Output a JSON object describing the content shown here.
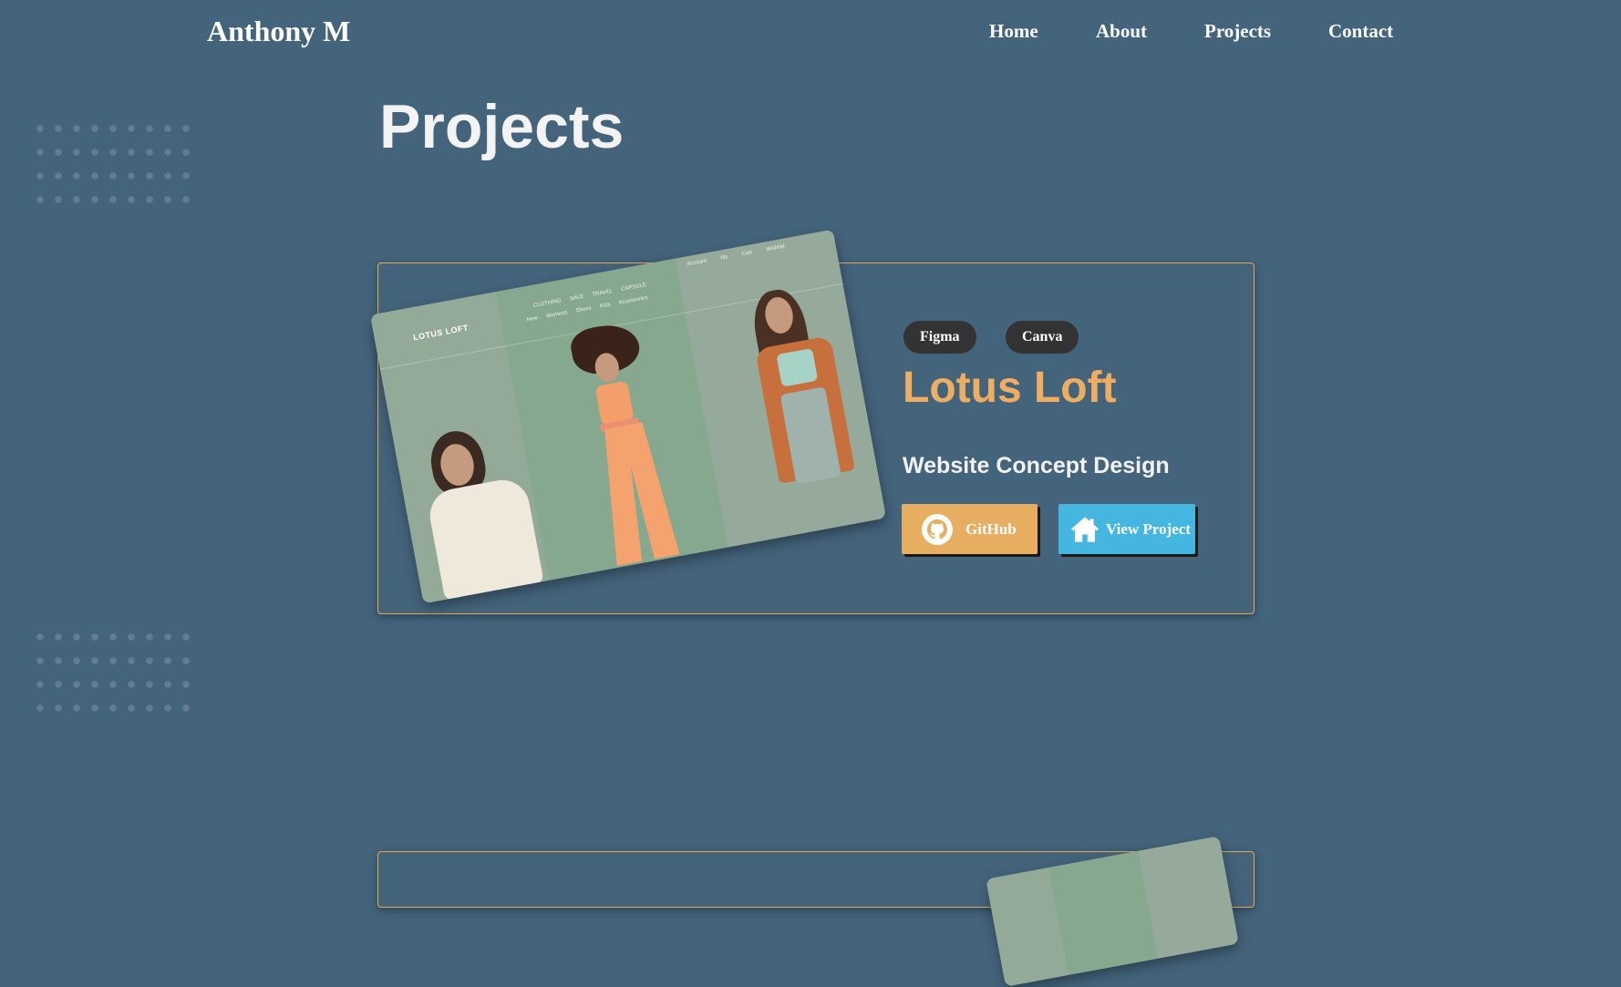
{
  "header": {
    "brand": "Anthony M",
    "nav": [
      {
        "label": "Home"
      },
      {
        "label": "About"
      },
      {
        "label": "Projects"
      },
      {
        "label": "Contact"
      }
    ]
  },
  "page": {
    "title": "Projects"
  },
  "projects": [
    {
      "tags": [
        "Figma",
        "Canva"
      ],
      "title": "Lotus Loft",
      "subtitle": "Website Concept Design",
      "github_label": "GitHub",
      "view_label": "View Project",
      "mockup": {
        "logo": "LOTUS LOFT",
        "menu_top": "CLOTHING SALE TRAVEL CAPSULE",
        "menu_sub": "New Womens Shoes Kids Accessories",
        "menu_right": "Account My Cart Wishlist"
      }
    }
  ],
  "colors": {
    "background": "#44647c",
    "accent_orange": "#efad61",
    "accent_blue": "#44b6e0",
    "tag_bg": "#333333"
  },
  "icons": {
    "github": "github-icon",
    "view": "home-icon"
  }
}
